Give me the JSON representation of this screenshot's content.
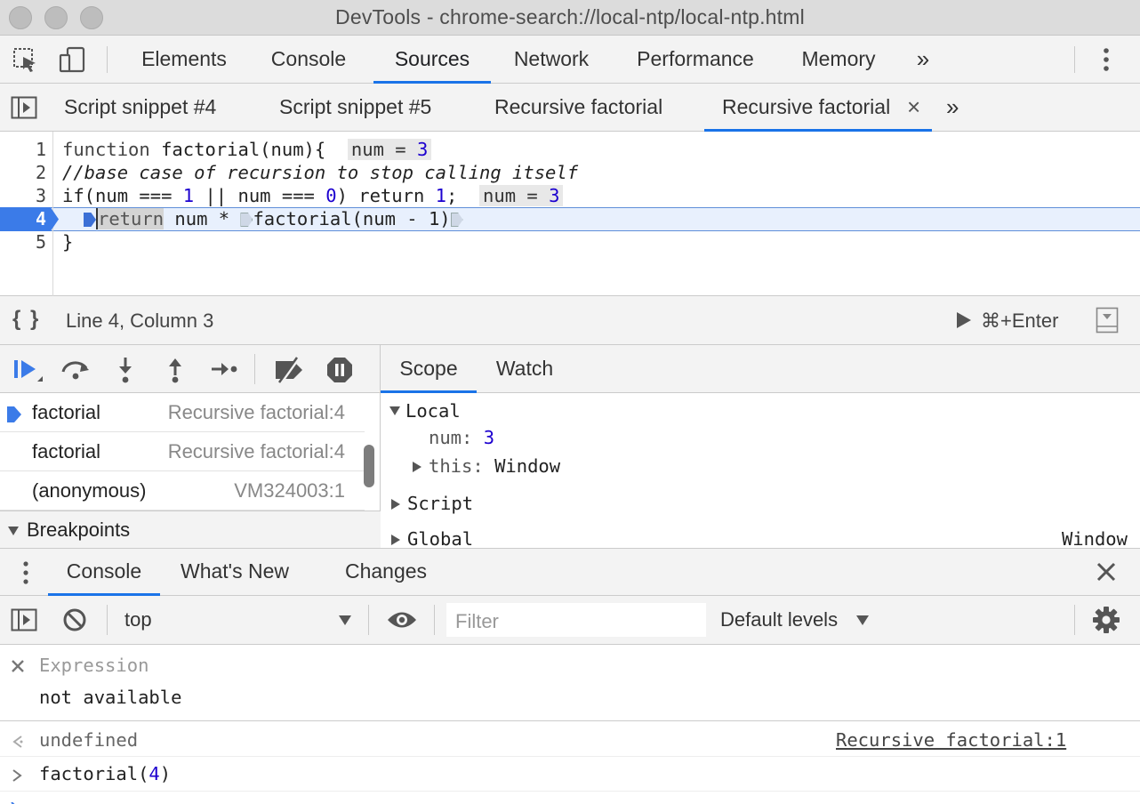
{
  "window": {
    "title": "DevTools - chrome-search://local-ntp/local-ntp.html"
  },
  "main_tabs": [
    {
      "label": "Elements"
    },
    {
      "label": "Console"
    },
    {
      "label": "Sources"
    },
    {
      "label": "Network"
    },
    {
      "label": "Performance"
    },
    {
      "label": "Memory"
    }
  ],
  "main_tabs_overflow": "»",
  "file_tabs": [
    {
      "label": "Script snippet #4"
    },
    {
      "label": "Script snippet #5"
    },
    {
      "label": "Recursive factorial"
    },
    {
      "label": "Recursive factorial"
    }
  ],
  "file_tabs_close": "×",
  "file_tabs_overflow": "»",
  "editor": {
    "line_numbers": [
      "1",
      "2",
      "3",
      "4",
      "5"
    ],
    "lines": {
      "l1_kw": "function",
      "l1_name": "factorial(num){",
      "l1_inline_label": "num = ",
      "l1_inline_value": "3",
      "l2": "//base case of recursion to stop calling itself",
      "l3_a": "if(num === ",
      "l3_n1": "1",
      "l3_b": " || num === ",
      "l3_n2": "0",
      "l3_c": ") return ",
      "l3_n3": "1",
      "l3_d": ";",
      "l3_inline_label": "num = ",
      "l3_inline_value": "3",
      "l4_return": "return",
      "l4_mid": " num * ",
      "l4_call": "factorial(num - 1)",
      "l5": "}"
    }
  },
  "status": {
    "pretty_print": "{ }",
    "position": "Line 4, Column 3",
    "run_shortcut": "⌘+Enter"
  },
  "call_stack": [
    {
      "fn": "factorial",
      "location": "Recursive factorial:4",
      "current": true
    },
    {
      "fn": "factorial",
      "location": "Recursive factorial:4",
      "current": false
    },
    {
      "fn": "(anonymous)",
      "location": "VM324003:1",
      "current": false
    }
  ],
  "breakpoints_label": "Breakpoints",
  "scope_tabs": [
    {
      "label": "Scope"
    },
    {
      "label": "Watch"
    }
  ],
  "scope": {
    "local_label": "Local",
    "num_key": "num:",
    "num_value": "3",
    "this_key": "this:",
    "this_value": "Window",
    "script_label": "Script",
    "global_label": "Global",
    "global_value": "Window"
  },
  "drawer_tabs": [
    {
      "label": "Console"
    },
    {
      "label": "What's New"
    },
    {
      "label": "Changes"
    }
  ],
  "console_toolbar": {
    "context": "top",
    "filter_placeholder": "Filter",
    "levels": "Default levels"
  },
  "console": {
    "expression_label": "Expression",
    "expression_value": "not available",
    "result_value": "undefined",
    "result_source": "Recursive factorial:1",
    "input_prefix": "factorial(",
    "input_number": "4",
    "input_suffix": ")"
  },
  "colors": {
    "accent": "#1a73e8",
    "exec_line_bg": "#e8f0fd",
    "number_literal": "#1c00cf",
    "keyword": "#881280"
  }
}
